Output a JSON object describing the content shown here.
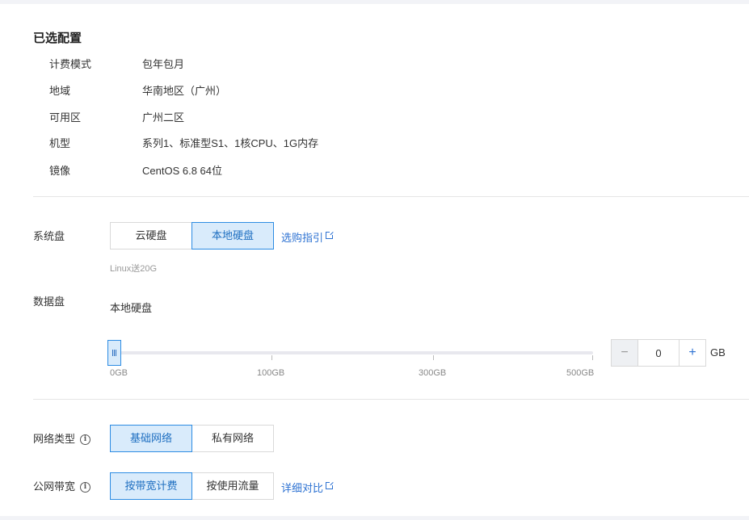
{
  "summary": {
    "title": "已选配置",
    "rows": [
      {
        "key": "计费模式",
        "value": "包年包月"
      },
      {
        "key": "地域",
        "value": "华南地区（广州）"
      },
      {
        "key": "可用区",
        "value": "广州二区"
      },
      {
        "key": "机型",
        "value": "系列1、标准型S1、1核CPU、1G内存"
      },
      {
        "key": "镜像",
        "value": "CentOS 6.8 64位"
      }
    ]
  },
  "system_disk": {
    "label": "系统盘",
    "options": [
      "云硬盘",
      "本地硬盘"
    ],
    "selected": "本地硬盘",
    "guide_link": "选购指引",
    "hint": "Linux送20G"
  },
  "data_disk": {
    "label": "数据盘",
    "type_value": "本地硬盘",
    "slider_value_gb": 0,
    "slider_ticks": [
      "0GB",
      "100GB",
      "300GB",
      "500GB"
    ],
    "stepper_value": "0",
    "stepper_minus": "−",
    "stepper_plus": "+",
    "unit": "GB"
  },
  "network_type": {
    "label": "网络类型",
    "options": [
      "基础网络",
      "私有网络"
    ],
    "selected": "基础网络"
  },
  "bandwidth": {
    "label": "公网带宽",
    "options": [
      "按带宽计费",
      "按使用流量"
    ],
    "selected": "按带宽计费",
    "compare_link": "详细对比"
  },
  "icons": {
    "info": "i"
  },
  "colors": {
    "accent": "#2d8ce3",
    "active_bg": "#d9ebfb",
    "link": "#2d72d2"
  }
}
